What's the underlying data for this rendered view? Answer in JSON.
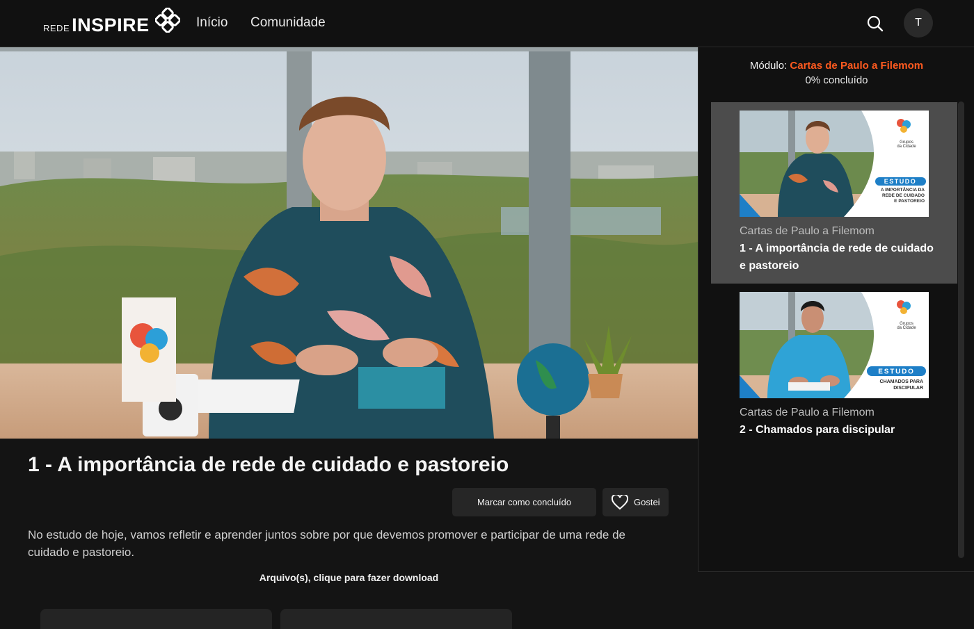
{
  "header": {
    "logo_small": "REDE",
    "logo_big": "INSPIRE",
    "nav": [
      "Início",
      "Comunidade"
    ],
    "search_icon": "search-icon",
    "avatar_initial": "T"
  },
  "lesson": {
    "title": "1 - A importância de rede de cuidado e pastoreio",
    "mark_done_label": "Marcar como concluído",
    "like_label": "Gostei",
    "description": "No estudo de hoje, vamos refletir e aprender juntos sobre por que devemos promover e participar de uma rede de cuidado e pastoreio.",
    "files_label": "Arquivo(s), clique para fazer download"
  },
  "sidebar": {
    "module_prefix": "Módulo: ",
    "module_name": "Cartas de Paulo a Filemom",
    "progress": "0% concluído",
    "items": [
      {
        "series": "Cartas de Paulo a Filemom",
        "name": "1 - A importância de rede de cuidado e pastoreio",
        "thumb_badge": "ESTUDO",
        "thumb_caption": [
          "A IMPORTÂNCIA DA",
          "REDE DE CUIDADO",
          "E PASTOREIO"
        ],
        "thumb_logo": [
          "Grupos",
          "da Cidade"
        ],
        "active": true
      },
      {
        "series": "Cartas de Paulo a Filemom",
        "name": "2 - Chamados para discipular",
        "thumb_badge": "ESTUDO",
        "thumb_caption": [
          "CHAMADOS PARA",
          "DISCIPULAR"
        ],
        "thumb_logo": [
          "Grupos",
          "da Cidade"
        ],
        "active": false
      }
    ]
  },
  "colors": {
    "accent": "#ff5a1f",
    "background": "#141414",
    "badge_blue": "#1e7fc7"
  }
}
